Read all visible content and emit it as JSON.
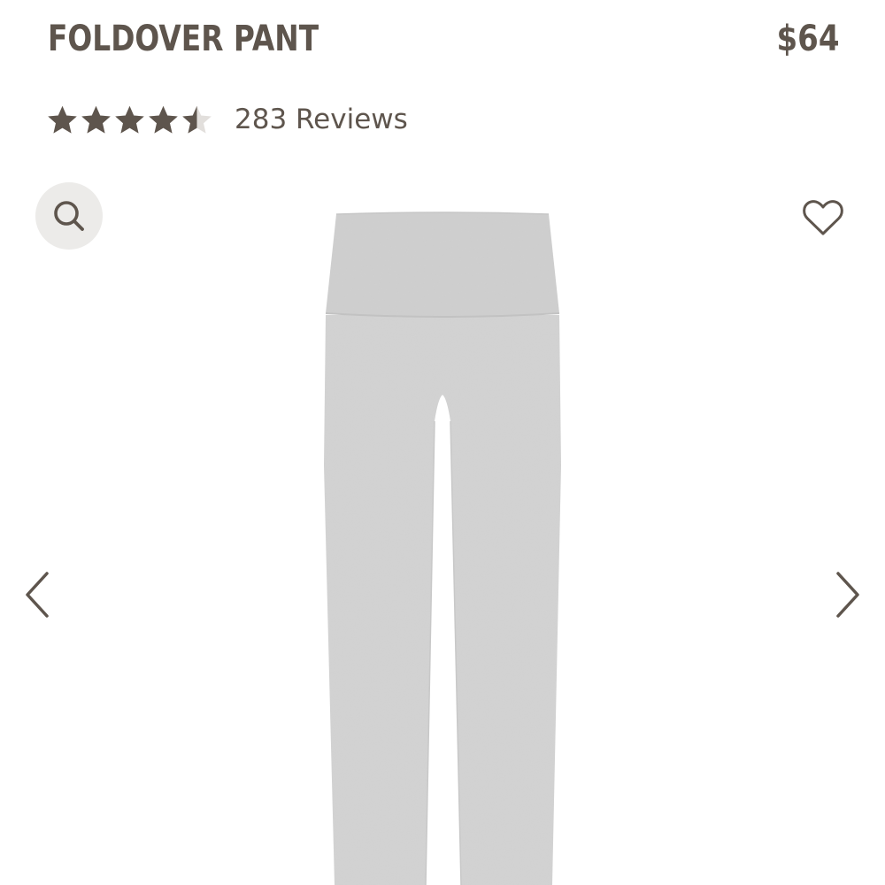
{
  "product": {
    "title": "FOLDOVER PANT",
    "price": "$64",
    "rating": {
      "value": 4.5,
      "max": 5,
      "reviews_label": "283 Reviews"
    }
  },
  "controls": {
    "zoom_icon": "search-icon",
    "wishlist_icon": "heart-icon",
    "prev_icon": "chevron-left-icon",
    "next_icon": "chevron-right-icon"
  },
  "colors": {
    "text": "#5e554d",
    "zoom_bg": "#ecebe9",
    "garment": "#d3d3d3"
  }
}
